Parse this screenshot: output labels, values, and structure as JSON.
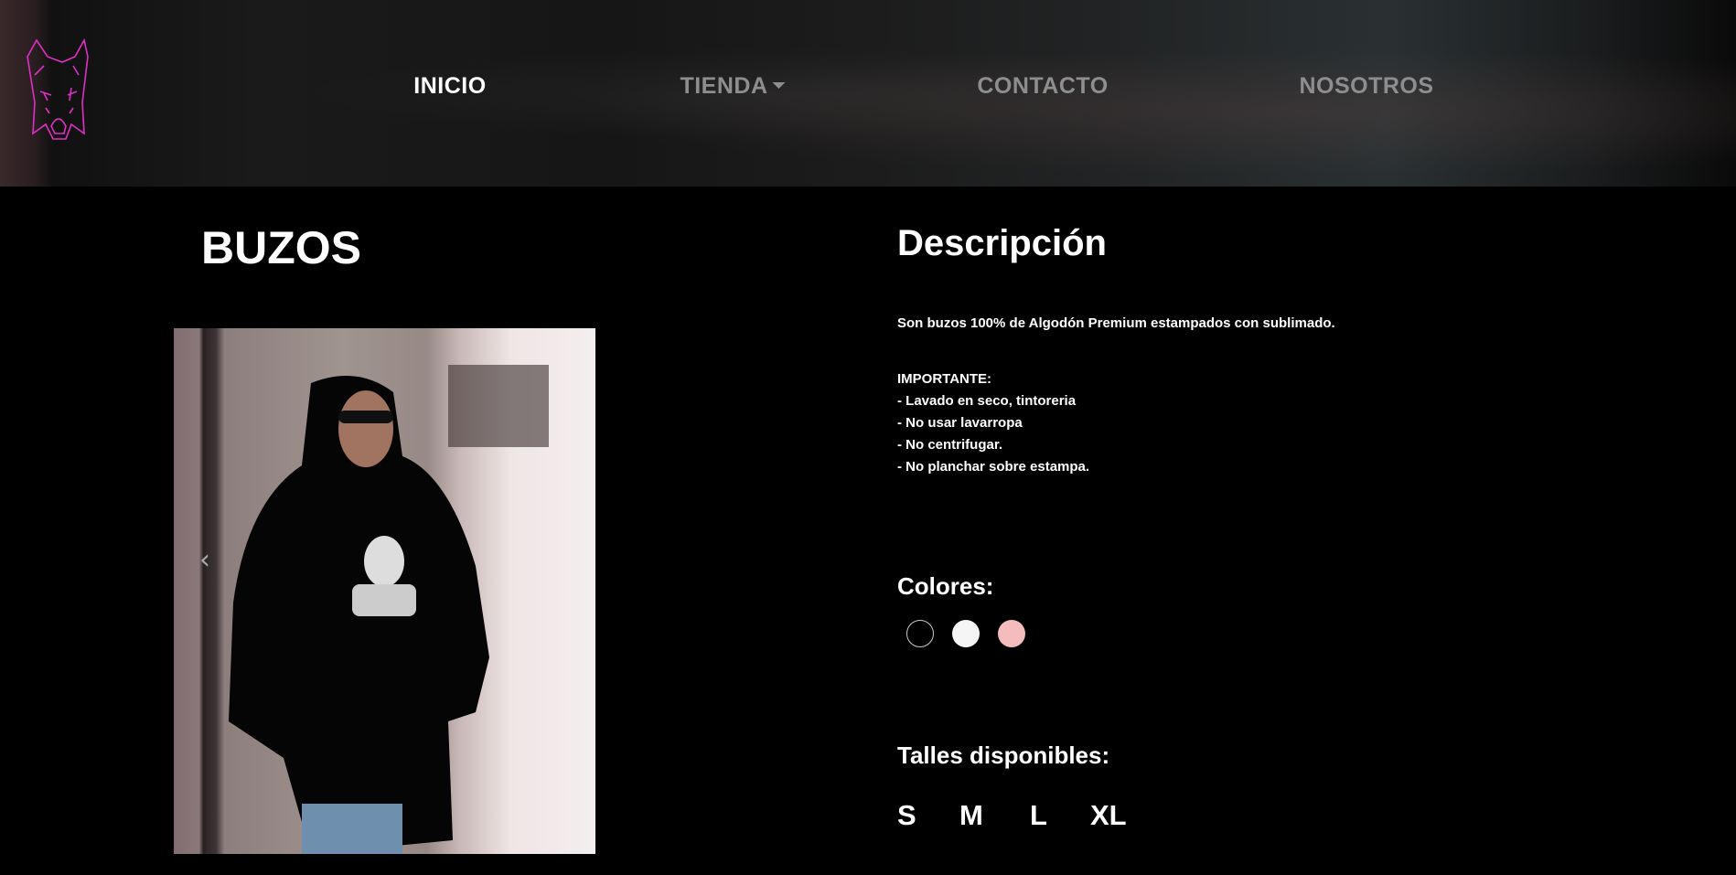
{
  "nav": {
    "items": [
      {
        "label": "INICIO"
      },
      {
        "label": "TIENDA"
      },
      {
        "label": "CONTACTO"
      },
      {
        "label": "NOSOTROS"
      }
    ]
  },
  "brand": {
    "logo_color": "#e02fc4"
  },
  "product": {
    "title": "BUZOS",
    "description_heading": "Descripción",
    "description": "Son buzos 100% de Algodón Premium estampados con sublimado.",
    "important_label": "IMPORTANTE:",
    "care": [
      "- Lavado en seco, tintoreria",
      "- No usar lavarropa",
      "- No centrifugar.",
      "- No planchar sobre estampa."
    ],
    "colors_heading": "Colores:",
    "colors": [
      "#000000",
      "#f5f5f5",
      "#f4bcbc"
    ],
    "sizes_heading": "Talles disponibles:",
    "sizes": [
      "S",
      "M",
      "L",
      "XL"
    ],
    "carousel_prev": "‹"
  }
}
